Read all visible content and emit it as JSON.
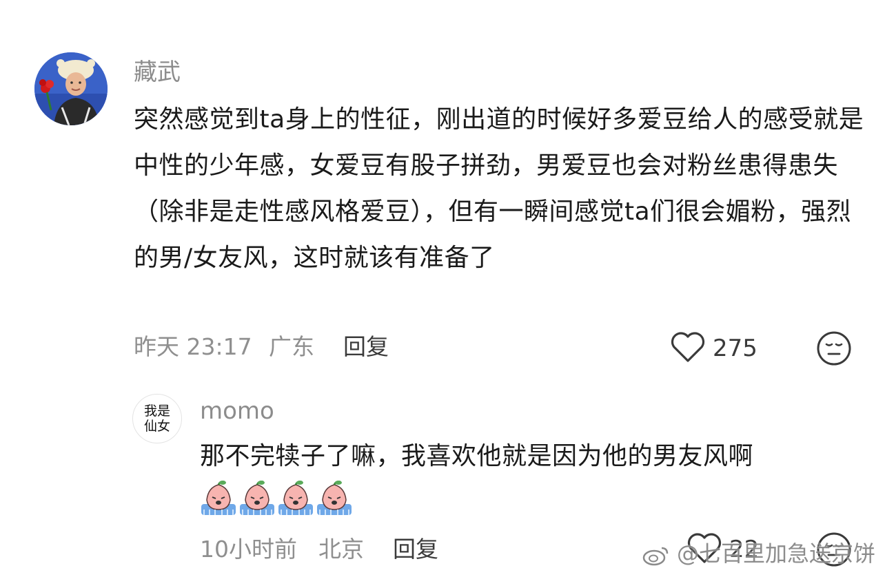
{
  "comment": {
    "username": "藏武",
    "text": "突然感觉到ta身上的性征，刚出道的时候好多爱豆给人的感受就是中性的少年感，女爱豆有股子拼劲，男爱豆也会对粉丝患得患失（除非是走性感风格爱豆），但有一瞬间感觉ta们很会媚粉，强烈的男/女友风，这时就该有准备了",
    "time": "昨天 23:17",
    "location": "广东",
    "reply_label": "回复",
    "like_count": "275",
    "like_icon": "heart-outline-icon",
    "reaction_icon": "neutral-face-icon"
  },
  "reply": {
    "username": "momo",
    "avatar_text_line1": "我是",
    "avatar_text_line2": "仙女",
    "text": "那不完犊子了嘛，我喜欢他就是因为他的男友风啊",
    "emoji_icon": "crying-peach-emoji",
    "emoji_count": 4,
    "time": "10小时前",
    "location": "北京",
    "reply_label": "回复",
    "like_count": "22",
    "like_icon": "heart-outline-icon",
    "reaction_icon": "neutral-face-icon"
  },
  "watermark": "@七百里加急送京饼"
}
